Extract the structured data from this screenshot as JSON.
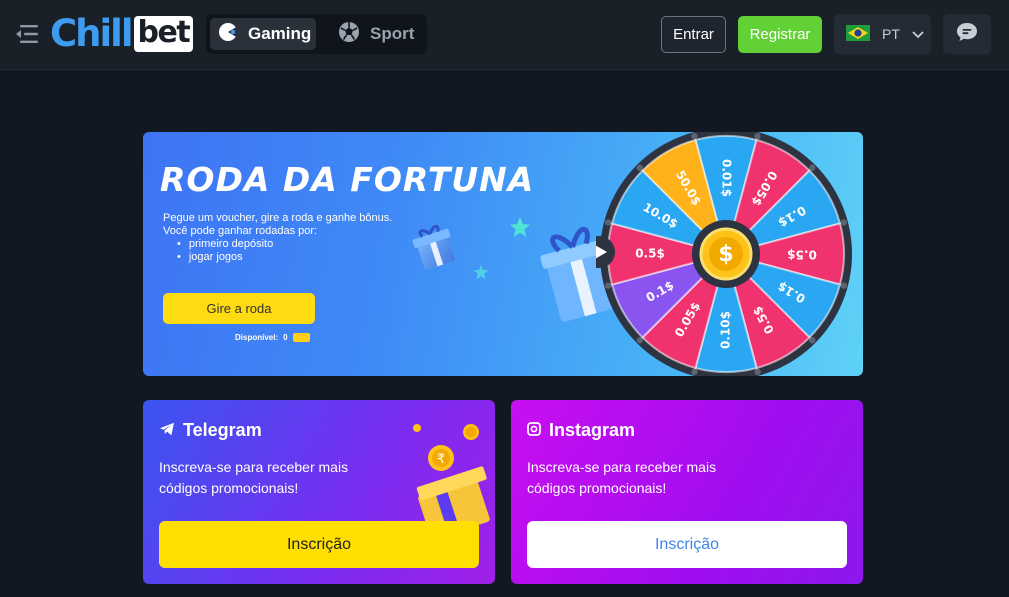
{
  "header": {
    "logo_part1": "Chill",
    "logo_part2": "bet",
    "tabs": [
      {
        "label": "Gaming",
        "icon": "pacman-icon",
        "active": true
      },
      {
        "label": "Sport",
        "icon": "soccer-ball-icon",
        "active": false
      }
    ],
    "login_label": "Entrar",
    "register_label": "Registrar",
    "language": {
      "code": "PT",
      "flag": "brazil-flag-icon"
    },
    "chat_icon": "chat-icon",
    "menu_icon": "menu-collapse-icon"
  },
  "banner": {
    "title": "RODA DA FORTUNA",
    "line1": "Pegue um voucher, gire a roda e ganhe bônus.",
    "line2": "Você pode ganhar rodadas por:",
    "bullets": [
      "primeiro depósito",
      "jogar jogos"
    ],
    "spin_label": "Gire a roda",
    "available_label": "Disponível:",
    "available_count": "0",
    "wheel_segments": [
      "0.01$",
      "0.05$",
      "0.1$",
      "0.5$",
      "0.1$",
      "0.5$",
      "0.10$",
      "0.05$",
      "0.1$",
      "0.5$",
      "10.0$",
      "50.0$"
    ],
    "wheel_center_icon": "dollar-coin-icon"
  },
  "cards": {
    "telegram": {
      "title": "Telegram",
      "icon": "telegram-icon",
      "text": "Inscreva-se para receber mais códigos promocionais!",
      "button": "Inscrição"
    },
    "instagram": {
      "title": "Instagram",
      "icon": "instagram-icon",
      "text": "Inscreva-se para receber mais códigos promocionais!",
      "button": "Inscrição"
    }
  },
  "colors": {
    "background": "#121821",
    "header": "#1a2028",
    "register_green": "#62d135",
    "spin_yellow": "#ffdb11",
    "logo_blue": "#3d9bf0"
  }
}
